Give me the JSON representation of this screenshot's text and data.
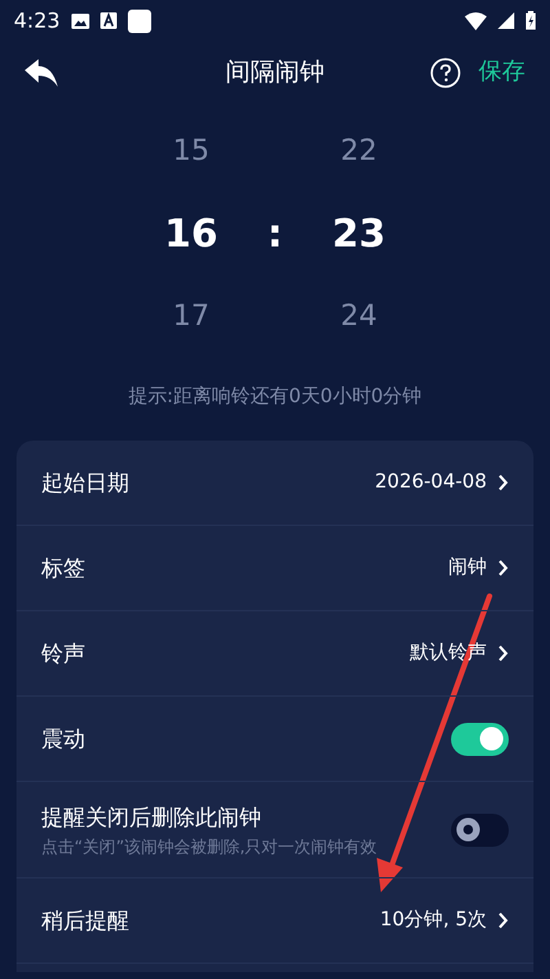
{
  "status_bar": {
    "time": "4:23"
  },
  "header": {
    "title": "间隔闹钟",
    "action": "保存"
  },
  "picker": {
    "separator": ":",
    "columns": [
      {
        "values": [
          {
            "text": "15",
            "selected": false
          },
          {
            "text": "16",
            "selected": true
          },
          {
            "text": "17",
            "selected": false
          }
        ]
      },
      {
        "values": [
          {
            "text": "22",
            "selected": false
          },
          {
            "text": "23",
            "selected": true
          },
          {
            "text": "24",
            "selected": false
          }
        ]
      }
    ]
  },
  "hint": "提示:距离响铃还有0天0小时0分钟",
  "settings": [
    {
      "kind": "link",
      "label": "起始日期",
      "value": "2026-04-08"
    },
    {
      "kind": "link",
      "label": "标签",
      "value": "闹钟"
    },
    {
      "kind": "link",
      "label": "铃声",
      "value": "默认铃声"
    },
    {
      "kind": "toggle",
      "label": "震动",
      "on": true
    },
    {
      "kind": "toggle",
      "label": "提醒关闭后删除此闹钟",
      "sublabel": "点击“关闭”该闹钟会被删除,只对一次闹钟有效",
      "on": false
    },
    {
      "kind": "link",
      "label": "稍后提醒",
      "value": "10分钟, 5次"
    }
  ]
}
